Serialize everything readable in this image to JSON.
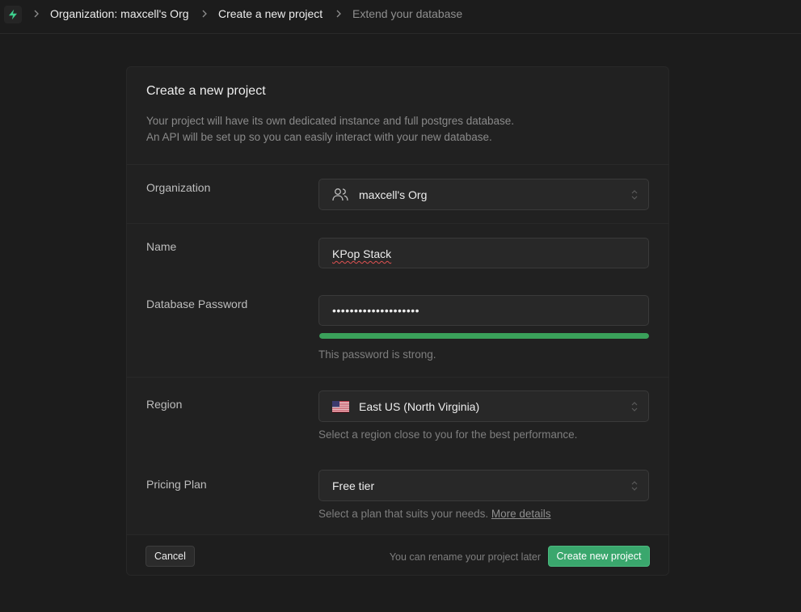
{
  "breadcrumb": {
    "items": [
      {
        "label": "Organization: maxcell's Org"
      },
      {
        "label": "Create a new project"
      },
      {
        "label": "Extend your database"
      }
    ]
  },
  "card": {
    "title": "Create a new project",
    "description_line1": "Your project will have its own dedicated instance and full postgres database.",
    "description_line2": "An API will be set up so you can easily interact with your new database."
  },
  "form": {
    "organization": {
      "label": "Organization",
      "value": "maxcell's Org",
      "icon": "users-icon"
    },
    "name": {
      "label": "Name",
      "value": "KPop Stack"
    },
    "password": {
      "label": "Database Password",
      "value": "••••••••••••••••••••",
      "strength": 1.0,
      "strength_message": "This password is strong."
    },
    "region": {
      "label": "Region",
      "value": "East US (North Virginia)",
      "icon": "us-flag-icon",
      "help": "Select a region close to you for the best performance."
    },
    "pricing_plan": {
      "label": "Pricing Plan",
      "value": "Free tier",
      "help": "Select a plan that suits your needs.",
      "help_link": "More details"
    }
  },
  "footer": {
    "cancel_label": "Cancel",
    "note": "You can rename your project later",
    "create_label": "Create new project"
  },
  "colors": {
    "brand": "#3ecf8e",
    "strength_bar": "#3aa15a",
    "background": "#1c1c1c"
  }
}
